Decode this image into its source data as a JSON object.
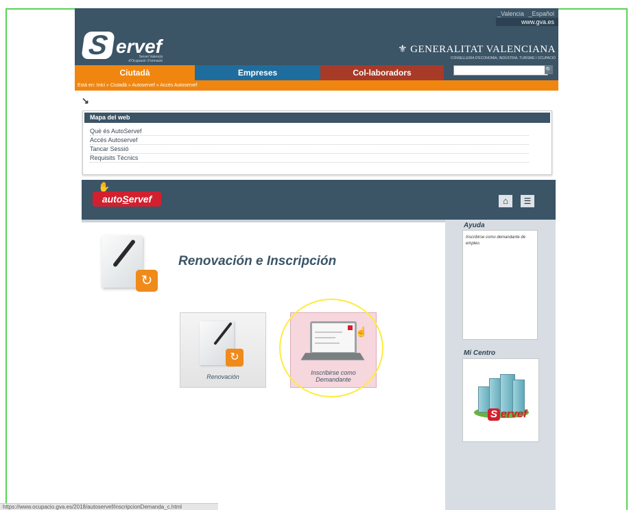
{
  "header": {
    "lang_valencia": "_Valencia",
    "lang_espanol": "_Español",
    "gva_link": "www.gva.es",
    "logo_text": "ervef",
    "logo_letter": "S",
    "logo_sub": "Servei Valencià d'Ocupació i Formació",
    "generalitat": "GENERALITAT VALENCIANA",
    "generalitat_sub": "CONSELLERIA D'ECONOMIA, INDÚSTRIA, TURISME I OCUPACIÓ"
  },
  "tabs": {
    "ciutada": "Ciutadà",
    "empreses": "Empreses",
    "colaboradors": "Col-laboradors"
  },
  "search": {
    "placeholder": "",
    "icon": "magnifier-icon"
  },
  "breadcrumb": "Està en: Inici » Ciutadà » Autoservef » Accés Autoservef",
  "sitemap": {
    "title": "Mapa del web",
    "items": [
      "Què és AutoServef",
      "Accés Autoservef",
      "Tancar Sessió",
      "Requisits Tècnics"
    ]
  },
  "autoservef": {
    "logo_a": "auto",
    "logo_s": "S",
    "logo_b": "ervef",
    "home_icon": "home-icon",
    "menu_icon": "list-icon"
  },
  "main": {
    "title": "Renovación e Inscripción",
    "card_renovacion": "Renovación",
    "card_inscribirse_1": "Inscribirse como",
    "card_inscribirse_2": "Demandante"
  },
  "sidebar": {
    "ayuda_title": "Ayuda",
    "ayuda_text": "Inscribirse como demandante de empleo.",
    "centro_title": "Mi Centro",
    "centro_logo": "ervef",
    "centro_logo_s": "S"
  },
  "status_bar": "https://www.ocupacio.gva.es/2018/autoservef/inscripcionDemanda_c.html",
  "colors": {
    "primary": "#3b5466",
    "orange": "#f0860f",
    "blue": "#1f6d9e",
    "red": "#a83a28",
    "brand_red": "#d2202f",
    "highlight": "#ffeb3b"
  }
}
